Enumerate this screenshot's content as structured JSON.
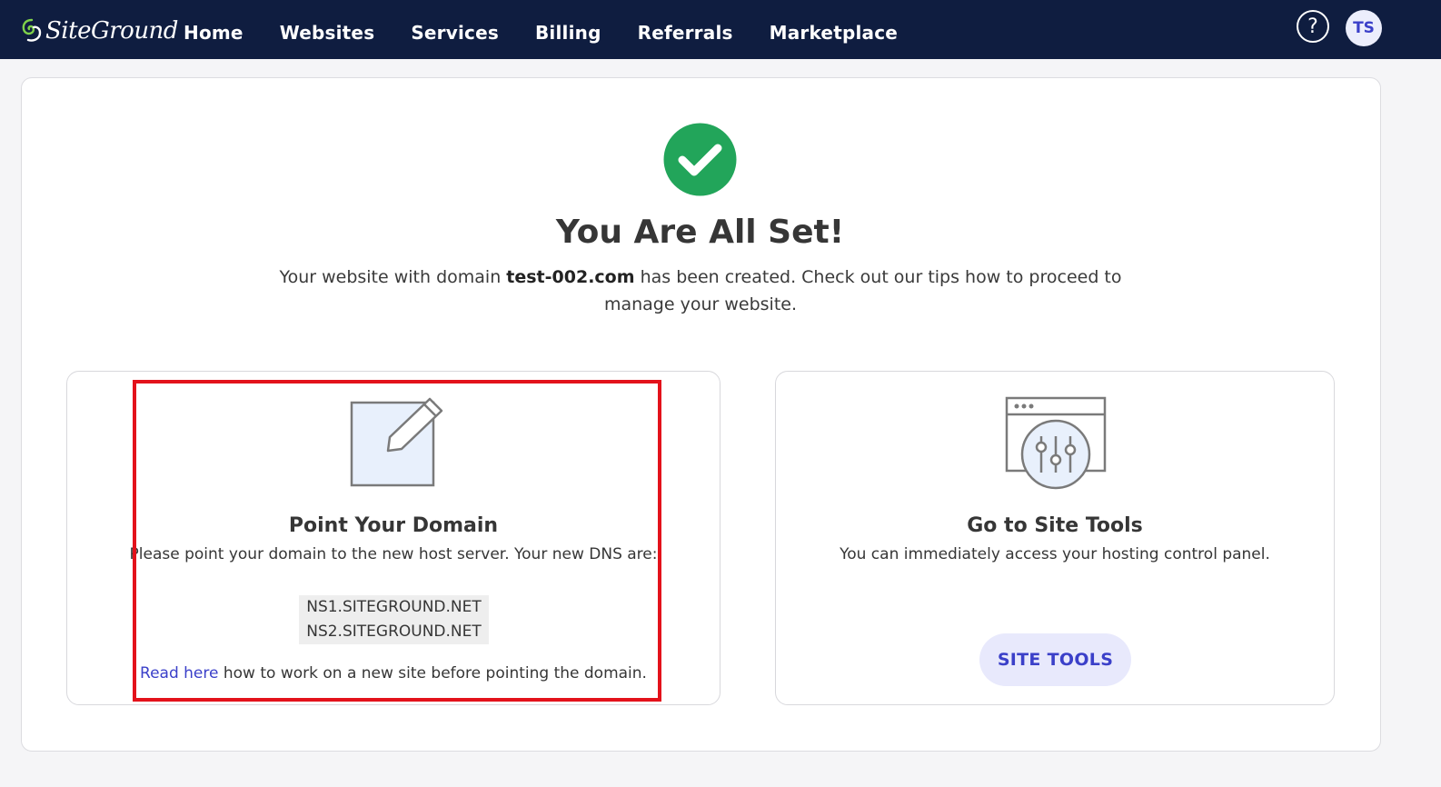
{
  "app": {
    "logo_text": "SiteGround"
  },
  "nav": {
    "items": [
      {
        "label": "Home"
      },
      {
        "label": "Websites"
      },
      {
        "label": "Services"
      },
      {
        "label": "Billing"
      },
      {
        "label": "Referrals"
      },
      {
        "label": "Marketplace"
      }
    ],
    "help_label": "?",
    "avatar_initials": "TS"
  },
  "main": {
    "headline": "You Are All Set!",
    "sub_prefix": "Your website with domain ",
    "domain": "test-002.com",
    "sub_suffix": " has been created. Check out our tips how to proceed to manage your website."
  },
  "point_domain": {
    "title": "Point Your Domain",
    "description": "Please point your domain to the new host server. Your new DNS are:",
    "dns": [
      "NS1.SITEGROUND.NET",
      "NS2.SITEGROUND.NET"
    ],
    "read_link": "Read here",
    "read_rest": " how to work on a new site before pointing the domain."
  },
  "site_tools": {
    "title": "Go to Site Tools",
    "description": "You can immediately access your hosting control panel.",
    "button_label": "SITE TOOLS"
  },
  "colors": {
    "nav_bg": "#0f1d40",
    "success_green": "#22a55a",
    "accent_blue": "#3b40c9",
    "highlight_red": "#e3121b"
  }
}
